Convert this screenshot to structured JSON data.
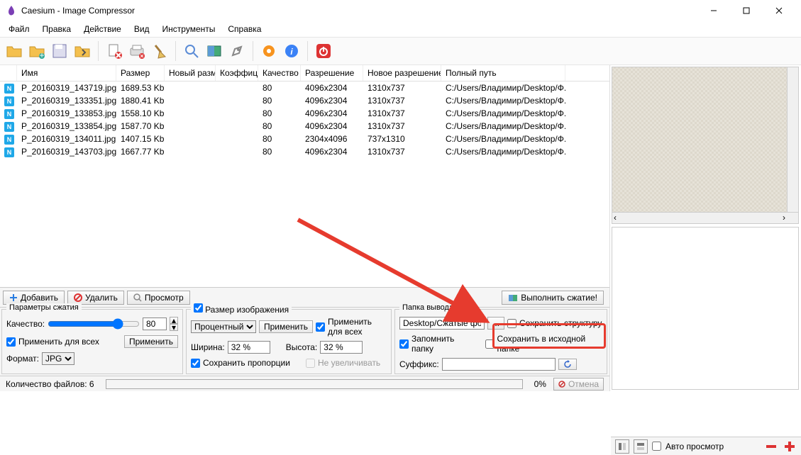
{
  "title": "Caesium - Image Compressor",
  "menu": {
    "file": "Файл",
    "edit": "Правка",
    "action": "Действие",
    "view": "Вид",
    "tools": "Инструменты",
    "help": "Справка"
  },
  "columns": {
    "name": "Имя",
    "size": "Размер",
    "newsize": "Новый разм",
    "ratio": "Коэффици",
    "quality": "Качество",
    "res": "Разрешение",
    "newres": "Новое разрешение",
    "path": "Полный путь"
  },
  "rows": [
    {
      "name": "P_20160319_143719.jpg",
      "size": "1689.53 Kb",
      "quality": "80",
      "res": "4096x2304",
      "newres": "1310x737",
      "path": "C:/Users/Владимир/Desktop/Ф..."
    },
    {
      "name": "P_20160319_133351.jpg",
      "size": "1880.41 Kb",
      "quality": "80",
      "res": "4096x2304",
      "newres": "1310x737",
      "path": "C:/Users/Владимир/Desktop/Ф..."
    },
    {
      "name": "P_20160319_133853.jpg",
      "size": "1558.10 Kb",
      "quality": "80",
      "res": "4096x2304",
      "newres": "1310x737",
      "path": "C:/Users/Владимир/Desktop/Ф..."
    },
    {
      "name": "P_20160319_133854.jpg",
      "size": "1587.70 Kb",
      "quality": "80",
      "res": "4096x2304",
      "newres": "1310x737",
      "path": "C:/Users/Владимир/Desktop/Ф..."
    },
    {
      "name": "P_20160319_134011.jpg",
      "size": "1407.15 Kb",
      "quality": "80",
      "res": "2304x4096",
      "newres": "737x1310",
      "path": "C:/Users/Владимир/Desktop/Ф..."
    },
    {
      "name": "P_20160319_143703.jpg",
      "size": "1667.77 Kb",
      "quality": "80",
      "res": "4096x2304",
      "newres": "1310x737",
      "path": "C:/Users/Владимир/Desktop/Ф..."
    }
  ],
  "actions": {
    "add": "Добавить",
    "delete": "Удалить",
    "preview": "Просмотр",
    "compress": "Выполнить сжатие!"
  },
  "compression": {
    "legend": "Параметры сжатия",
    "quality_label": "Качество:",
    "quality_value": "80",
    "apply_all": "Применить для всех",
    "apply": "Применить",
    "format_label": "Формат:",
    "format_value": "JPG"
  },
  "resize": {
    "legend": "Размер изображения",
    "method": "Процентный",
    "apply": "Применить",
    "apply_all": "Применить для всех",
    "width_label": "Ширина:",
    "width_value": "32 %",
    "height_label": "Высота:",
    "height_value": "32 %",
    "keep_proportions": "Сохранить пропорции",
    "no_enlarge": "Не увеличивать"
  },
  "output": {
    "legend": "Папка вывода",
    "folder": "Desktop/Сжатые фото",
    "browse": "...",
    "keep_structure": "Сохранить структуру",
    "remember": "Запомнить папку",
    "save_source": "Сохранить в исходной папке",
    "suffix_label": "Суффикс:",
    "suffix_value": ""
  },
  "footer": {
    "count": "Количество файлов: 6",
    "progress": "0%",
    "cancel": "Отмена",
    "autopreview": "Авто просмотр"
  }
}
